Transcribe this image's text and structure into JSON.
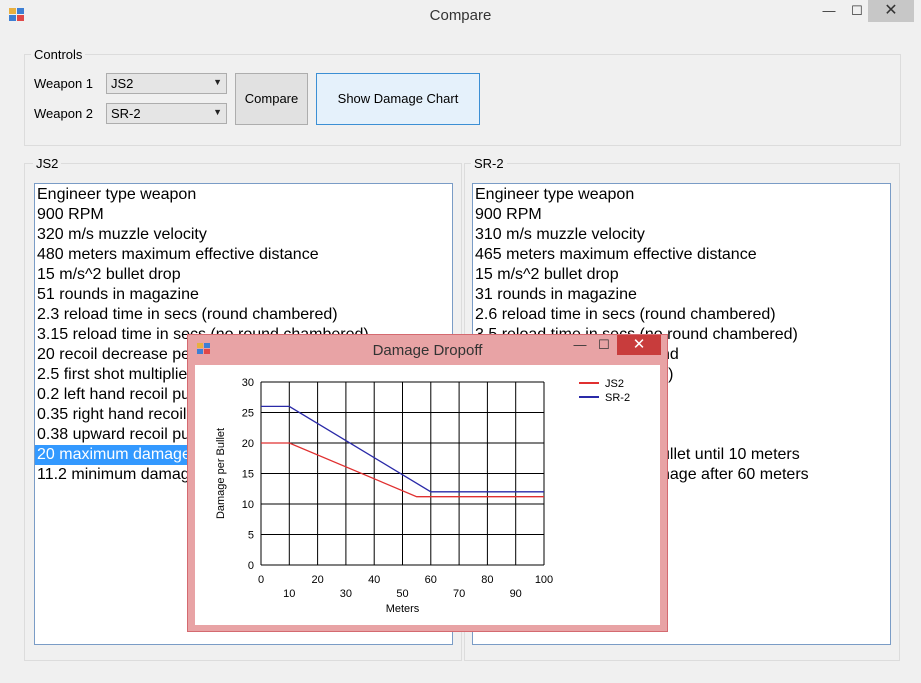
{
  "window": {
    "title": "Compare",
    "minimize": "—",
    "maximize": "☐",
    "close": "✕"
  },
  "controls": {
    "group_label": "Controls",
    "weapon1_label": "Weapon 1",
    "weapon1_value": "JS2",
    "weapon2_label": "Weapon 2",
    "weapon2_value": "SR-2",
    "compare_button": "Compare",
    "chart_button": "Show Damage Chart"
  },
  "left_panel": {
    "label": "JS2",
    "items": [
      "Engineer type weapon",
      "900 RPM",
      "320 m/s muzzle velocity",
      "480 meters maximum effective distance",
      "15 m/s^2 bullet drop",
      "51 rounds in magazine",
      "2.3 reload time in secs (round chambered)",
      "3.15 reload time in secs (no round chambered)",
      "20 recoil decrease pe",
      "2.5 first shot multiplier",
      "0.2 left hand recoil pu",
      "0.35 right hand recoil",
      "0.38 upward recoil pu",
      "20 maximum damage",
      "11.2 minimum damag"
    ],
    "selected_index": 13
  },
  "right_panel": {
    "label": "SR-2",
    "items": [
      "Engineer type weapon",
      "900 RPM",
      "310 m/s muzzle velocity",
      "465 meters maximum effective distance",
      "15 m/s^2 bullet drop",
      "31 rounds in magazine",
      "2.6 reload time in secs (round chambered)",
      "3.5 reload time in secs (no round chambered)",
      "",
      "",
      "",
      "",
      "",
      "",
      ""
    ],
    "partial_items": [
      {
        "row": 8,
        "text": "nd"
      },
      {
        "row": 9,
        "text": "il)"
      },
      {
        "row": 13,
        "text": "ullet until 10 meters"
      },
      {
        "row": 14,
        "text": "nage after 60 meters"
      }
    ]
  },
  "dialog": {
    "title": "Damage Dropoff",
    "minimize": "—",
    "maximize": "☐",
    "close": "✕"
  },
  "chart_data": {
    "type": "line",
    "xlabel": "Meters",
    "ylabel": "Damage per Bullet",
    "xlim": [
      0,
      100
    ],
    "ylim": [
      0,
      30
    ],
    "xticks": [
      0,
      10,
      20,
      30,
      40,
      50,
      60,
      70,
      80,
      90,
      100
    ],
    "yticks": [
      0,
      5,
      10,
      15,
      20,
      25,
      30
    ],
    "grid": true,
    "legend": "top-right",
    "series": [
      {
        "name": "JS2",
        "color": "#e03030",
        "x": [
          0,
          10,
          55,
          100
        ],
        "y": [
          20,
          20,
          11.2,
          11.2
        ]
      },
      {
        "name": "SR-2",
        "color": "#2a2aa8",
        "x": [
          0,
          10,
          60,
          100
        ],
        "y": [
          26,
          26,
          12,
          12
        ]
      }
    ]
  }
}
